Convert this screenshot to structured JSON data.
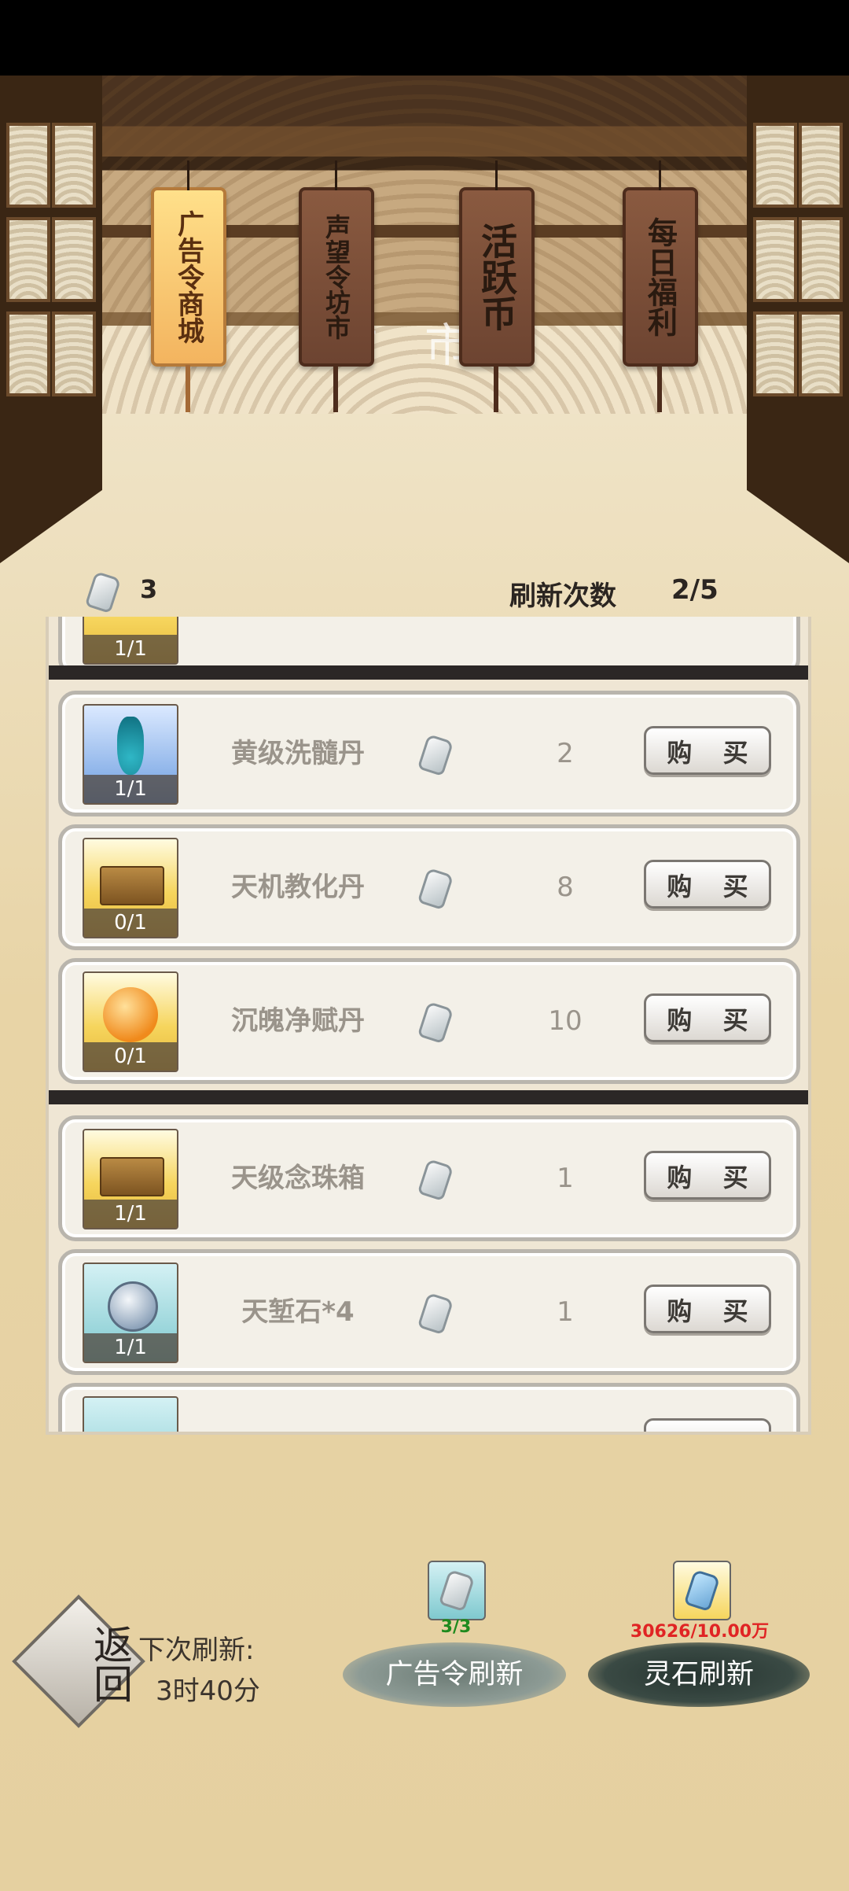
{
  "hall": {
    "title": "坊市"
  },
  "tabs": [
    {
      "label": "广告令商城",
      "active": true
    },
    {
      "label": "声望令坊市",
      "active": false
    },
    {
      "label": "活跃币",
      "active": false
    },
    {
      "label": "每日福利",
      "active": false
    }
  ],
  "info": {
    "currency_count": "3",
    "refresh_label": "刷新次数",
    "refresh_value": "2/5"
  },
  "shop": {
    "buy_label": "购 买",
    "partial_top": {
      "count": "1/1"
    },
    "items": [
      {
        "name": "黄级洗髓丹",
        "price": "2",
        "count": "1/1",
        "thumb": "vase-icon"
      },
      {
        "name": "天机教化丹",
        "price": "8",
        "count": "0/1",
        "thumb": "chest-icon"
      },
      {
        "name": "沉魄净赋丹",
        "price": "10",
        "count": "0/1",
        "thumb": "orb-icon"
      },
      {
        "name": "天级念珠箱",
        "price": "1",
        "count": "1/1",
        "thumb": "chest-icon"
      },
      {
        "name": "天堑石*4",
        "price": "1",
        "count": "1/1",
        "thumb": "coin-icon"
      }
    ]
  },
  "bottom": {
    "back_label": "返回",
    "next_label": "下次刷新:",
    "next_value": "3时40分",
    "ad_refresh_label": "广告令刷新",
    "ad_count": "3/3",
    "stone_refresh_label": "灵石刷新",
    "stone_count": "30626/10.00万"
  },
  "colors": {
    "ad_count": "#1e8a1e",
    "stone_count": "#e02424",
    "active_tab": "#f3b45f"
  }
}
